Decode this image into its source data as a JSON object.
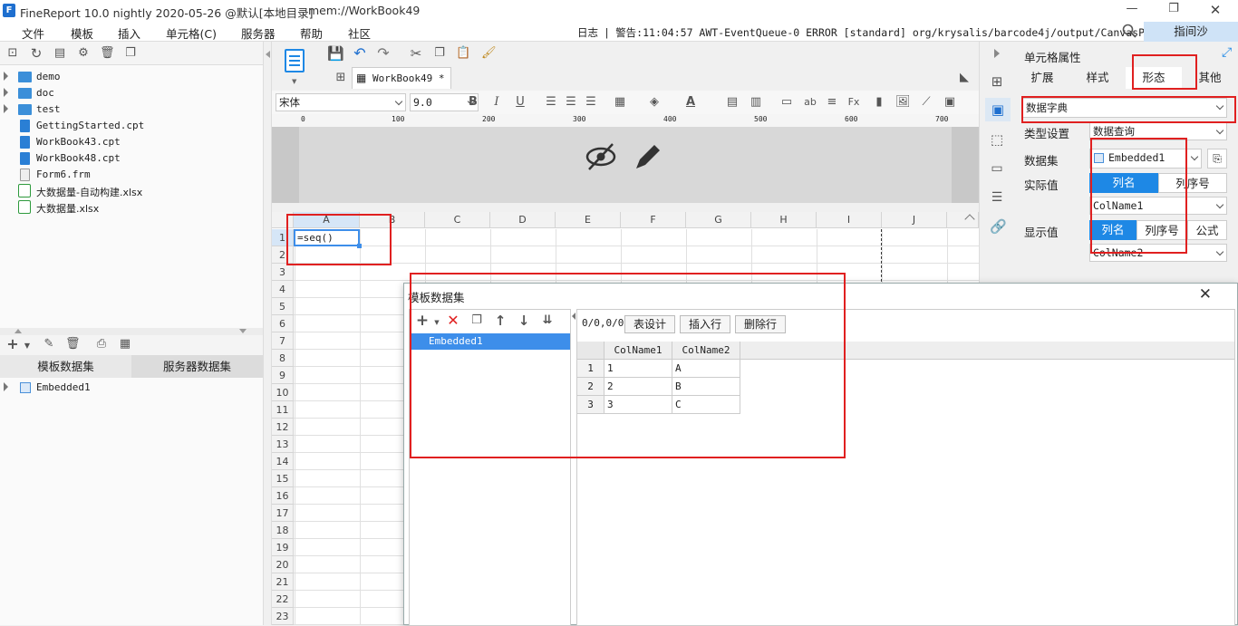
{
  "titlebar": {
    "app_title": "FineReport 10.0 nightly 2020-05-26 @默认[本地目录]",
    "doc_path": "mem://WorkBook49",
    "logo": "finereport-logo-icon"
  },
  "menu": {
    "items": [
      "文件",
      "模板",
      "插入",
      "单元格(C)",
      "服务器",
      "帮助",
      "社区"
    ]
  },
  "log": {
    "label": "日志",
    "separator": "|",
    "warning": "警告:11:04:57 AWT-EventQueue-0 ERROR [standard] org/krysalis/barcode4j/output/CanvasProvider"
  },
  "user": {
    "name": "指间沙"
  },
  "tree": {
    "items": [
      {
        "label": "demo",
        "kind": "folder"
      },
      {
        "label": "doc",
        "kind": "folder"
      },
      {
        "label": "test",
        "kind": "folder"
      },
      {
        "label": "GettingStarted.cpt",
        "kind": "cpt"
      },
      {
        "label": "WorkBook43.cpt",
        "kind": "cpt"
      },
      {
        "label": "WorkBook48.cpt",
        "kind": "cpt"
      },
      {
        "label": "Form6.frm",
        "kind": "frm"
      },
      {
        "label": "大数据量-自动构建.xlsx",
        "kind": "xlsx"
      },
      {
        "label": "大数据量.xlsx",
        "kind": "xlsx"
      }
    ]
  },
  "dataset_tabs": {
    "template": "模板数据集",
    "server": "服务器数据集"
  },
  "dataset_list": {
    "items": [
      "Embedded1"
    ]
  },
  "editor": {
    "tab_label": "WorkBook49 *",
    "font_name": "宋体",
    "font_size": "9.0",
    "ruler_ticks": [
      "0",
      "100",
      "200",
      "300",
      "400",
      "500",
      "600",
      "700"
    ],
    "columns": [
      "A",
      "B",
      "C",
      "D",
      "E",
      "F",
      "G",
      "H",
      "I",
      "J"
    ],
    "rows": [
      "1",
      "2",
      "3",
      "4",
      "5",
      "6",
      "7",
      "8",
      "9",
      "10",
      "11",
      "12",
      "13",
      "14",
      "15",
      "16",
      "17",
      "18",
      "19",
      "20",
      "21",
      "22",
      "23"
    ],
    "cell_a1": "=seq()"
  },
  "props": {
    "title": "单元格属性",
    "tabs": [
      "扩展",
      "样式",
      "形态",
      "其他"
    ],
    "active_tab": "形态",
    "form_type": "数据字典",
    "type_label": "类型设置",
    "type_value": "数据查询",
    "dataset_label": "数据集",
    "dataset_value": "Embedded1",
    "actual_label": "实际值",
    "actual_seg": [
      "列名",
      "列序号"
    ],
    "actual_value": "ColName1",
    "display_label": "显示值",
    "display_seg": [
      "列名",
      "列序号",
      "公式"
    ],
    "display_value": "ColName2"
  },
  "dialog": {
    "title": "模板数据集",
    "dataset_item": "Embedded1",
    "counter": "0/0,0/0",
    "btn_design": "表设计",
    "btn_insert": "插入行",
    "btn_delete": "删除行",
    "table_headers": [
      "ColName1",
      "ColName2"
    ],
    "table_rows": [
      {
        "idx": "1",
        "c1": "1",
        "c2": "A"
      },
      {
        "idx": "2",
        "c1": "2",
        "c2": "B"
      },
      {
        "idx": "3",
        "c1": "3",
        "c2": "C"
      }
    ]
  },
  "colors": {
    "accent": "#1e88e5",
    "highlight": "#e02020",
    "selection": "#3d8eea"
  }
}
